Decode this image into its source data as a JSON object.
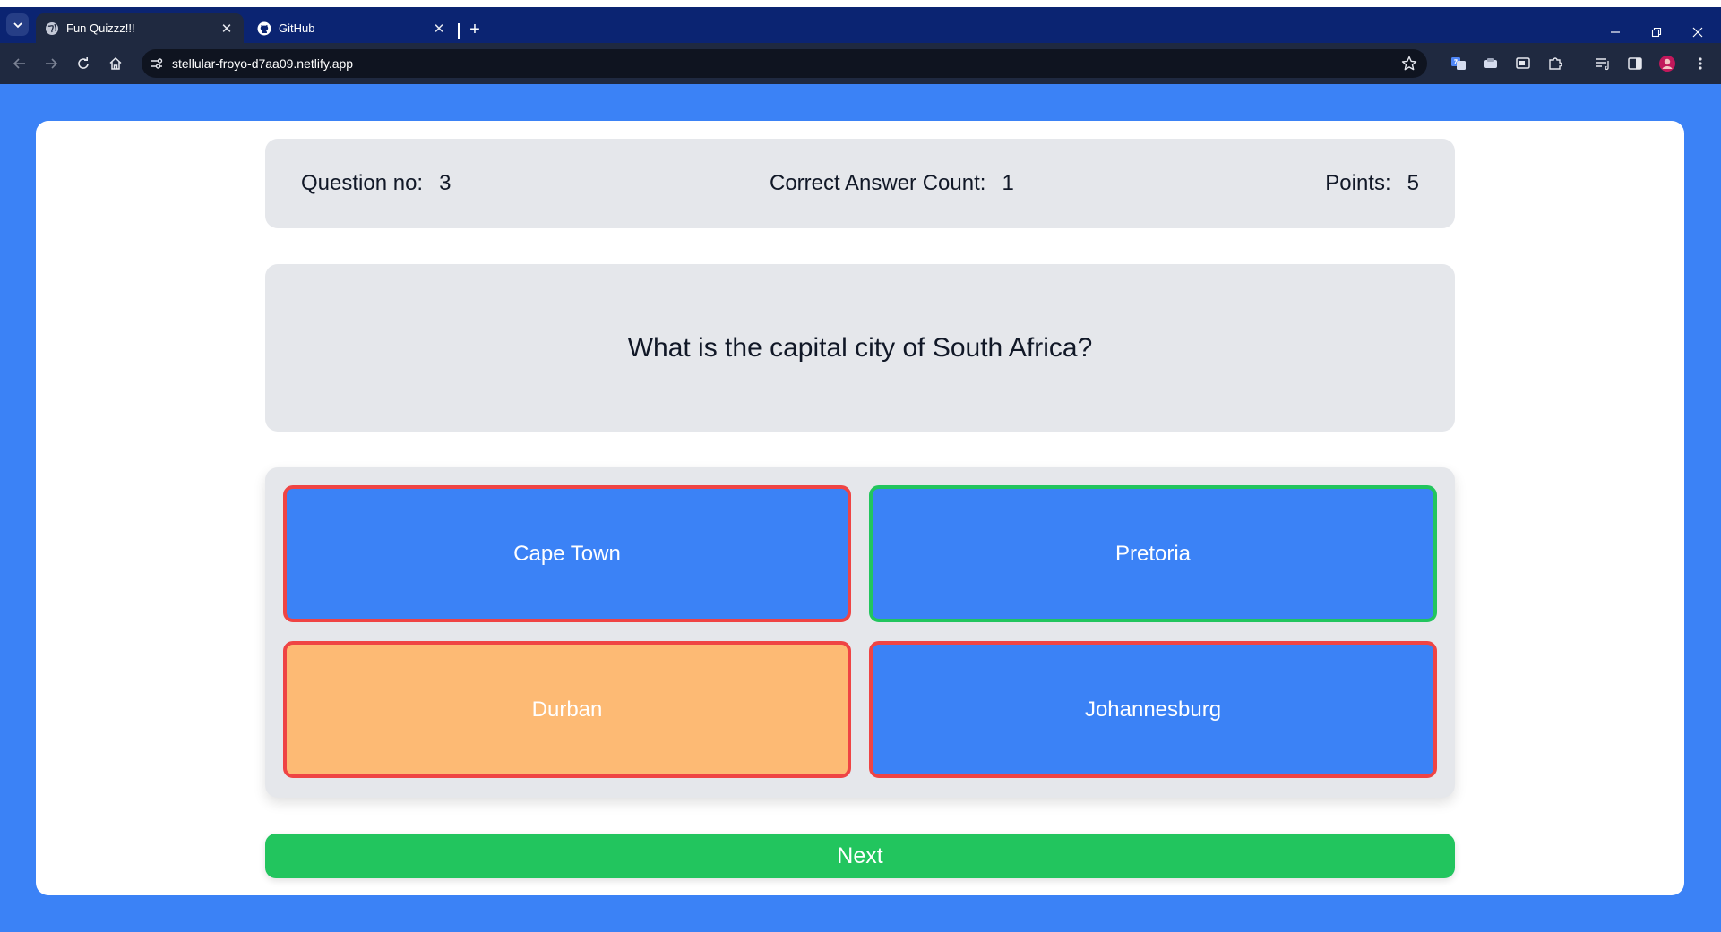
{
  "browser": {
    "tabs": [
      {
        "title": "Fun Quizzz!!!",
        "active": true,
        "icon": "globe-icon"
      },
      {
        "title": "GitHub",
        "active": false,
        "icon": "github-icon"
      }
    ],
    "url": "stellular-froyo-d7aa09.netlify.app"
  },
  "quiz": {
    "question_no_label": "Question no:",
    "question_no": "3",
    "correct_count_label": "Correct Answer Count:",
    "correct_count": "1",
    "points_label": "Points:",
    "points": "5",
    "question": "What is the capital city of South Africa?",
    "options": [
      {
        "label": "Cape Town",
        "state": "wrong"
      },
      {
        "label": "Pretoria",
        "state": "correct"
      },
      {
        "label": "Durban",
        "state": "selected-wrong"
      },
      {
        "label": "Johannesburg",
        "state": "wrong"
      }
    ],
    "next_label": "Next"
  },
  "colors": {
    "page_background": "#3b82f6",
    "option_background": "#3b82f6",
    "selected_option_background": "#fdba74",
    "wrong_border": "#ef4444",
    "correct_border": "#22c55e",
    "next_button": "#22c55e",
    "panel_background": "#e5e7eb"
  }
}
